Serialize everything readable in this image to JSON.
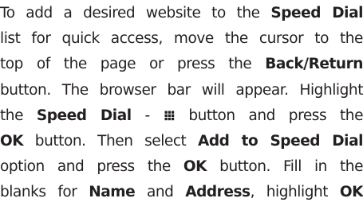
{
  "paragraph": {
    "lines": [
      [
        {
          "t": "To add a desired website to the "
        },
        {
          "t": "Speed Dial",
          "b": true
        }
      ],
      [
        {
          "t": "list for quick access, move the cursor to the"
        }
      ],
      [
        {
          "t": "top of the page or press the "
        },
        {
          "t": "Back/Return",
          "b": true
        }
      ],
      [
        {
          "t": "button. The browser bar will appear. Highlight"
        }
      ],
      [
        {
          "t": "the "
        },
        {
          "t": "Speed Dial",
          "b": true
        },
        {
          "t": " - "
        },
        {
          "icon": "speed-dial-grid-icon"
        },
        {
          "t": " button and press the"
        }
      ],
      [
        {
          "t": "OK",
          "b": true
        },
        {
          "t": " button. Then select "
        },
        {
          "t": "Add to Speed Dial",
          "b": true
        }
      ],
      [
        {
          "t": "option and press the "
        },
        {
          "t": "OK",
          "b": true
        },
        {
          "t": " button. Fill in the"
        }
      ],
      [
        {
          "t": "blanks for "
        },
        {
          "t": "Name",
          "b": true
        },
        {
          "t": " and "
        },
        {
          "t": "Address",
          "b": true
        },
        {
          "t": ", highlight "
        },
        {
          "t": "OK",
          "b": true
        }
      ]
    ]
  },
  "colors": {
    "text": "#231f20"
  }
}
